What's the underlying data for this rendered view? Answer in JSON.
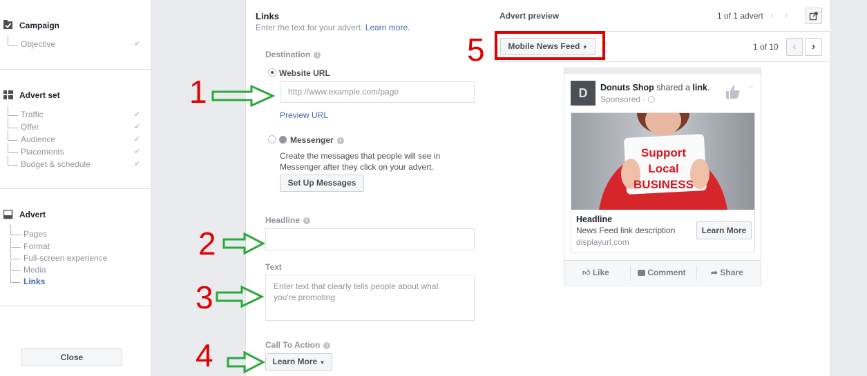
{
  "nav": {
    "sections": [
      {
        "title": "Campaign",
        "items": [
          {
            "label": "Objective",
            "checked": true
          }
        ]
      },
      {
        "title": "Advert set",
        "items": [
          {
            "label": "Traffic",
            "checked": true
          },
          {
            "label": "Offer",
            "checked": true
          },
          {
            "label": "Audience",
            "checked": true
          },
          {
            "label": "Placements",
            "checked": true
          },
          {
            "label": "Budget & schedule",
            "checked": true
          }
        ]
      },
      {
        "title": "Advert",
        "items": [
          {
            "label": "Pages"
          },
          {
            "label": "Format"
          },
          {
            "label": "Full-screen experience"
          },
          {
            "label": "Media"
          },
          {
            "label": "Links",
            "active": true
          }
        ]
      }
    ],
    "close_label": "Close"
  },
  "form": {
    "title": "Links",
    "subtitle": "Enter the text for your advert.",
    "learn_more_link": "Learn more.",
    "destination_label": "Destination",
    "website_url_label": "Website URL",
    "url_placeholder": "http://www.example.com/page",
    "preview_url": "Preview URL",
    "messenger_label": "Messenger",
    "messenger_desc_1": "Create the messages that people will see in",
    "messenger_desc_2": "Messenger after they click on your advert.",
    "setup_messages": "Set Up Messages",
    "headline_label": "Headline",
    "text_label": "Text",
    "text_placeholder_1": "Enter text that clearly tells people about what",
    "text_placeholder_2": "you're promoting",
    "cta_label": "Call To Action",
    "cta_value": "Learn More"
  },
  "preview": {
    "title": "Advert preview",
    "advert_count": "1 of 1 advert",
    "placement_select": "Mobile News Feed",
    "page_count": "1 of 10",
    "post": {
      "avatar_letter": "D",
      "page_name": "Donuts Shop",
      "shared_text": "shared a",
      "link_word": "link",
      "sponsored": "Sponsored",
      "image_text_1": "Support",
      "image_text_2": "Local",
      "image_text_3": "BUSINESS",
      "headline": "Headline",
      "description": "News Feed link description",
      "display_url": "displayurl.com",
      "cta": "Learn More",
      "actions": {
        "like": "Like",
        "comment": "Comment",
        "share": "Share"
      }
    }
  },
  "annotations": [
    "1",
    "2",
    "3",
    "4",
    "5"
  ],
  "colors": {
    "annotation_red": "#e00000",
    "annotation_green": "#2aa83a",
    "link_blue": "#4267b2"
  }
}
